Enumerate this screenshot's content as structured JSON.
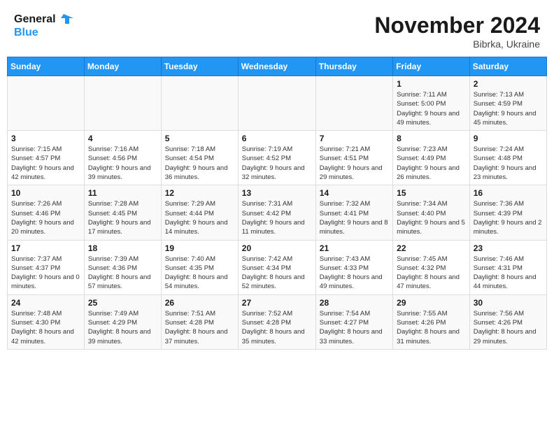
{
  "header": {
    "logo_general": "General",
    "logo_blue": "Blue",
    "month_title": "November 2024",
    "location": "Bibrka, Ukraine"
  },
  "days_of_week": [
    "Sunday",
    "Monday",
    "Tuesday",
    "Wednesday",
    "Thursday",
    "Friday",
    "Saturday"
  ],
  "weeks": [
    [
      {
        "day": "",
        "info": ""
      },
      {
        "day": "",
        "info": ""
      },
      {
        "day": "",
        "info": ""
      },
      {
        "day": "",
        "info": ""
      },
      {
        "day": "",
        "info": ""
      },
      {
        "day": "1",
        "info": "Sunrise: 7:11 AM\nSunset: 5:00 PM\nDaylight: 9 hours and 49 minutes."
      },
      {
        "day": "2",
        "info": "Sunrise: 7:13 AM\nSunset: 4:59 PM\nDaylight: 9 hours and 45 minutes."
      }
    ],
    [
      {
        "day": "3",
        "info": "Sunrise: 7:15 AM\nSunset: 4:57 PM\nDaylight: 9 hours and 42 minutes."
      },
      {
        "day": "4",
        "info": "Sunrise: 7:16 AM\nSunset: 4:56 PM\nDaylight: 9 hours and 39 minutes."
      },
      {
        "day": "5",
        "info": "Sunrise: 7:18 AM\nSunset: 4:54 PM\nDaylight: 9 hours and 36 minutes."
      },
      {
        "day": "6",
        "info": "Sunrise: 7:19 AM\nSunset: 4:52 PM\nDaylight: 9 hours and 32 minutes."
      },
      {
        "day": "7",
        "info": "Sunrise: 7:21 AM\nSunset: 4:51 PM\nDaylight: 9 hours and 29 minutes."
      },
      {
        "day": "8",
        "info": "Sunrise: 7:23 AM\nSunset: 4:49 PM\nDaylight: 9 hours and 26 minutes."
      },
      {
        "day": "9",
        "info": "Sunrise: 7:24 AM\nSunset: 4:48 PM\nDaylight: 9 hours and 23 minutes."
      }
    ],
    [
      {
        "day": "10",
        "info": "Sunrise: 7:26 AM\nSunset: 4:46 PM\nDaylight: 9 hours and 20 minutes."
      },
      {
        "day": "11",
        "info": "Sunrise: 7:28 AM\nSunset: 4:45 PM\nDaylight: 9 hours and 17 minutes."
      },
      {
        "day": "12",
        "info": "Sunrise: 7:29 AM\nSunset: 4:44 PM\nDaylight: 9 hours and 14 minutes."
      },
      {
        "day": "13",
        "info": "Sunrise: 7:31 AM\nSunset: 4:42 PM\nDaylight: 9 hours and 11 minutes."
      },
      {
        "day": "14",
        "info": "Sunrise: 7:32 AM\nSunset: 4:41 PM\nDaylight: 9 hours and 8 minutes."
      },
      {
        "day": "15",
        "info": "Sunrise: 7:34 AM\nSunset: 4:40 PM\nDaylight: 9 hours and 5 minutes."
      },
      {
        "day": "16",
        "info": "Sunrise: 7:36 AM\nSunset: 4:39 PM\nDaylight: 9 hours and 2 minutes."
      }
    ],
    [
      {
        "day": "17",
        "info": "Sunrise: 7:37 AM\nSunset: 4:37 PM\nDaylight: 9 hours and 0 minutes."
      },
      {
        "day": "18",
        "info": "Sunrise: 7:39 AM\nSunset: 4:36 PM\nDaylight: 8 hours and 57 minutes."
      },
      {
        "day": "19",
        "info": "Sunrise: 7:40 AM\nSunset: 4:35 PM\nDaylight: 8 hours and 54 minutes."
      },
      {
        "day": "20",
        "info": "Sunrise: 7:42 AM\nSunset: 4:34 PM\nDaylight: 8 hours and 52 minutes."
      },
      {
        "day": "21",
        "info": "Sunrise: 7:43 AM\nSunset: 4:33 PM\nDaylight: 8 hours and 49 minutes."
      },
      {
        "day": "22",
        "info": "Sunrise: 7:45 AM\nSunset: 4:32 PM\nDaylight: 8 hours and 47 minutes."
      },
      {
        "day": "23",
        "info": "Sunrise: 7:46 AM\nSunset: 4:31 PM\nDaylight: 8 hours and 44 minutes."
      }
    ],
    [
      {
        "day": "24",
        "info": "Sunrise: 7:48 AM\nSunset: 4:30 PM\nDaylight: 8 hours and 42 minutes."
      },
      {
        "day": "25",
        "info": "Sunrise: 7:49 AM\nSunset: 4:29 PM\nDaylight: 8 hours and 39 minutes."
      },
      {
        "day": "26",
        "info": "Sunrise: 7:51 AM\nSunset: 4:28 PM\nDaylight: 8 hours and 37 minutes."
      },
      {
        "day": "27",
        "info": "Sunrise: 7:52 AM\nSunset: 4:28 PM\nDaylight: 8 hours and 35 minutes."
      },
      {
        "day": "28",
        "info": "Sunrise: 7:54 AM\nSunset: 4:27 PM\nDaylight: 8 hours and 33 minutes."
      },
      {
        "day": "29",
        "info": "Sunrise: 7:55 AM\nSunset: 4:26 PM\nDaylight: 8 hours and 31 minutes."
      },
      {
        "day": "30",
        "info": "Sunrise: 7:56 AM\nSunset: 4:26 PM\nDaylight: 8 hours and 29 minutes."
      }
    ]
  ]
}
